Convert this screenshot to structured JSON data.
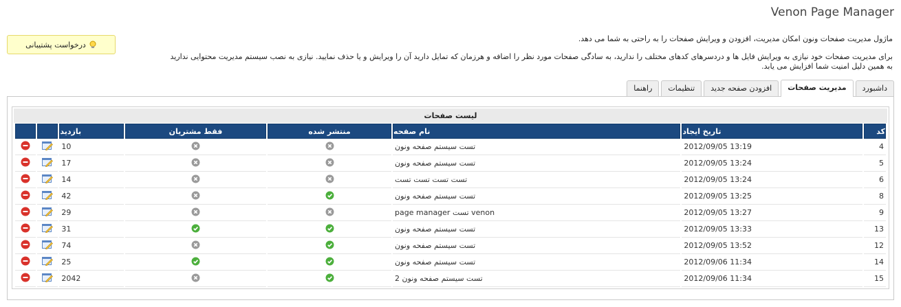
{
  "header": {
    "title": "Venon Page Manager"
  },
  "support_button": {
    "label": "درخواست پشتیبانی",
    "icon": "lightbulb-icon"
  },
  "intro": {
    "line1": "ماژول مدیریت صفحات ونون امکان مدیریت، افزودن و ویرایش صفحات را به راحتی به شما می دهد.",
    "line2": "برای مدیریت صفحات خود نیازی به ویرایش فایل ها و دردسرهای کدهای مختلف را ندارید، به سادگی صفحات مورد نظر را اضافه و هرزمان که تمایل دارید آن را ویرایش و یا حذف نمایید. نیازی به نصب سیستم مدیریت محتوایی ندارید",
    "line3": "به همین دلیل امنیت شما افزایش می یابد."
  },
  "tabs": [
    {
      "label": "داشبورد",
      "active": false
    },
    {
      "label": "مدیریت صفحات",
      "active": true
    },
    {
      "label": "افزودن صفحه جدید",
      "active": false
    },
    {
      "label": "تنظیمات",
      "active": false
    },
    {
      "label": "راهنما",
      "active": false
    }
  ],
  "table": {
    "caption": "لیست صفحات",
    "headers": {
      "id": "کد",
      "created": "تاریخ ایجاد",
      "name": "نام صفحه",
      "published": "منتشر شده",
      "members_only": "فقط مشتریان",
      "visits": "بازدید"
    },
    "rows": [
      {
        "id": "4",
        "created": "2012/09/05 13:19",
        "name": "تست سیستم صفحه ونون",
        "published": false,
        "members_only": false,
        "visits": "10"
      },
      {
        "id": "5",
        "created": "2012/09/05 13:24",
        "name": "تست سیستم صفحه ونون",
        "published": false,
        "members_only": false,
        "visits": "17"
      },
      {
        "id": "6",
        "created": "2012/09/05 13:24",
        "name": "تست تست تست تست",
        "published": false,
        "members_only": false,
        "visits": "14"
      },
      {
        "id": "8",
        "created": "2012/09/05 13:25",
        "name": "تست سیستم صفحه ونون",
        "published": true,
        "members_only": false,
        "visits": "42"
      },
      {
        "id": "9",
        "created": "2012/09/05 13:27",
        "name": "venon تست page manager",
        "published": false,
        "members_only": false,
        "visits": "29"
      },
      {
        "id": "13",
        "created": "2012/09/05 13:33",
        "name": "تست سیستم صفحه ونون",
        "published": true,
        "members_only": true,
        "visits": "31"
      },
      {
        "id": "12",
        "created": "2012/09/05 13:52",
        "name": "تست سیستم صفحه ونون",
        "published": true,
        "members_only": false,
        "visits": "74"
      },
      {
        "id": "14",
        "created": "2012/09/06 11:34",
        "name": "تست سیستم صفحه ونون",
        "published": true,
        "members_only": true,
        "visits": "25"
      },
      {
        "id": "15",
        "created": "2012/09/06 11:34",
        "name": "تست سیستم صفحه ونون 2",
        "published": true,
        "members_only": false,
        "visits": "2042"
      }
    ]
  },
  "colors": {
    "header_bg": "#1c4980",
    "status_on": "#4caf3c",
    "status_off": "#9a9a9a",
    "delete": "#d9322b",
    "support_bg": "#ffffcc"
  },
  "icons": {
    "published_on": "check-icon",
    "published_off": "cross-icon",
    "edit": "edit-icon",
    "delete": "delete-icon"
  }
}
